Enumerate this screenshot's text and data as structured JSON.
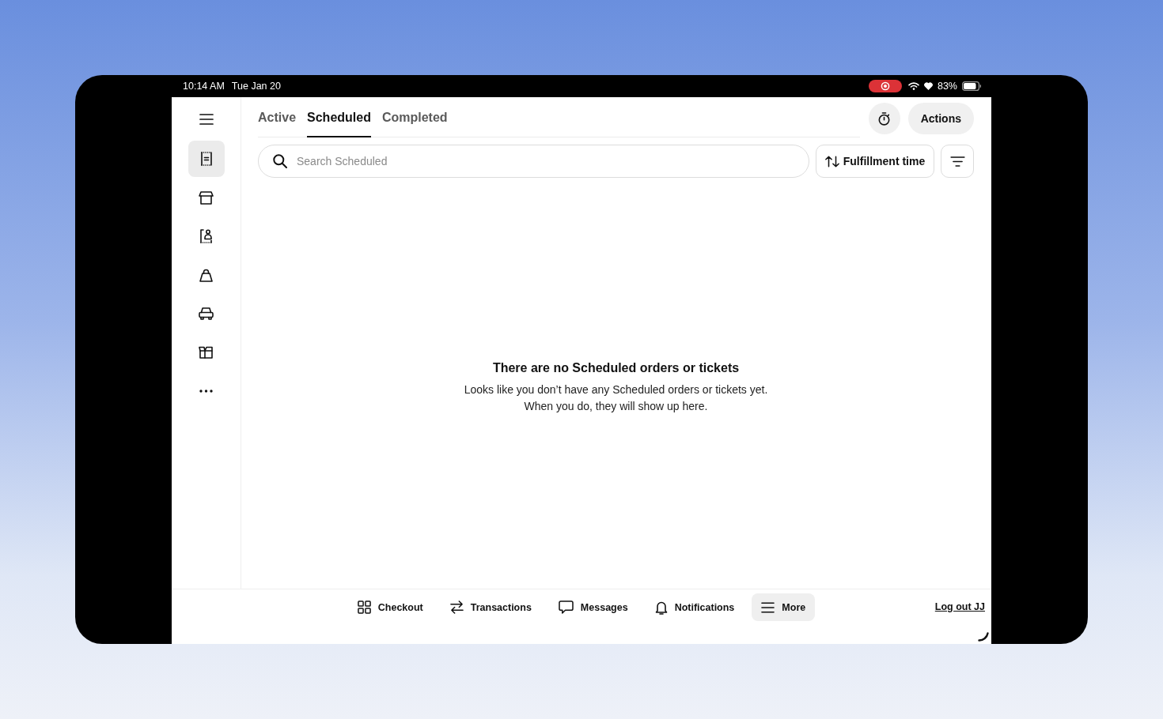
{
  "status_bar": {
    "time": "10:14 AM",
    "date": "Tue Jan 20",
    "recording": true,
    "battery_percent": "83%"
  },
  "sidebar": {
    "items": [
      {
        "selected": true
      },
      {
        "selected": false
      },
      {
        "selected": false
      },
      {
        "selected": false
      },
      {
        "selected": false
      },
      {
        "selected": false
      },
      {
        "selected": false
      }
    ]
  },
  "tabs": [
    {
      "label": "Active",
      "selected": false
    },
    {
      "label": "Scheduled",
      "selected": true
    },
    {
      "label": "Completed",
      "selected": false
    }
  ],
  "actions_button": {
    "label": "Actions"
  },
  "search": {
    "placeholder": "Search Scheduled"
  },
  "sort_button": {
    "label": "Fulfillment time"
  },
  "empty_state": {
    "title": "There are no Scheduled orders or tickets",
    "message": "Looks like you don’t have any Scheduled orders or tickets yet.\nWhen you do, they will show up here."
  },
  "bottom_nav": {
    "items": [
      {
        "label": "Checkout",
        "selected": false
      },
      {
        "label": "Transactions",
        "selected": false
      },
      {
        "label": "Messages",
        "selected": false
      },
      {
        "label": "Notifications",
        "selected": false
      },
      {
        "label": "More",
        "selected": true
      }
    ],
    "logout_link": "Log out JJ"
  }
}
